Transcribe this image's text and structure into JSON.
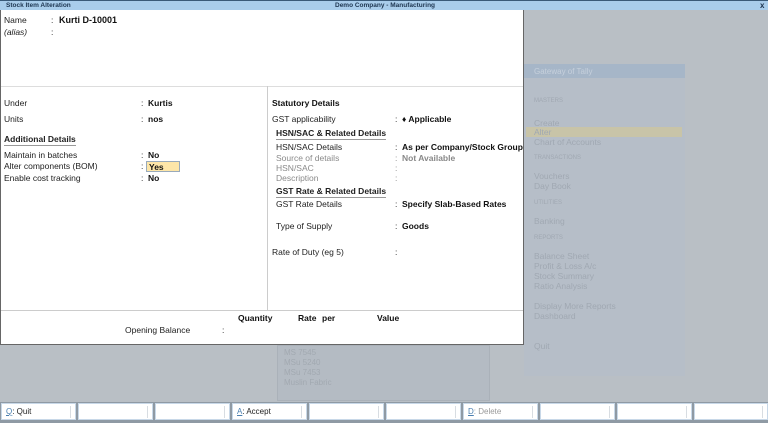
{
  "titlebar": {
    "screen": "Stock Item Alteration",
    "company": "Demo Company - Manufacturing",
    "close": "x"
  },
  "form": {
    "name_label": "Name",
    "name_value": "Kurti D-10001",
    "alias_label": "(alias)",
    "under_label": "Under",
    "under_value": "Kurtis",
    "units_label": "Units",
    "units_value": "nos",
    "additional_header": "Additional Details",
    "batches_label": "Maintain in batches",
    "batches_value": "No",
    "bom_label": "Alter components (BOM)",
    "bom_value": "Yes",
    "cost_label": "Enable cost tracking",
    "cost_value": "No",
    "statutory_header": "Statutory Details",
    "gst_app_label": "GST applicability",
    "gst_app_value": "♦ Applicable",
    "hsn_header": "HSN/SAC & Related Details",
    "hsn_details_label": "HSN/SAC Details",
    "hsn_details_value": "As per Company/Stock Group",
    "source_label": "Source of details",
    "source_value": "Not Available",
    "hsn_label": "HSN/SAC",
    "desc_label": "Description",
    "gst_rate_header": "GST Rate & Related Details",
    "gst_rate_label": "GST Rate Details",
    "gst_rate_value": "Specify Slab-Based Rates",
    "supply_label": "Type of Supply",
    "supply_value": "Goods",
    "duty_label": "Rate of Duty (eg 5)",
    "opening": {
      "quantity": "Quantity",
      "rate": "Rate",
      "per": "per",
      "value": "Value",
      "label": "Opening Balance"
    }
  },
  "gateway": {
    "title": "Gateway of Tally",
    "items": [
      "MASTERS",
      "Create",
      "Alter",
      "Chart of Accounts",
      "TRANSACTIONS",
      "Vouchers",
      "Day Book",
      "UTILITIES",
      "Banking",
      "REPORTS",
      "Balance Sheet",
      "Profit & Loss A/c",
      "Stock Summary",
      "Ratio Analysis",
      "Display More Reports",
      "Dashboard",
      "Quit"
    ]
  },
  "bglist": {
    "items": [
      "MS 7545",
      "MSu 5240",
      "MSu 7453",
      "Muslin Fabric"
    ]
  },
  "buttons": [
    {
      "key": "Q",
      "label": ": Quit"
    },
    {
      "key": "",
      "label": ""
    },
    {
      "key": "",
      "label": ""
    },
    {
      "key": "A",
      "label": ": Accept"
    },
    {
      "key": "",
      "label": ""
    },
    {
      "key": "",
      "label": ""
    },
    {
      "key": "D",
      "label": ": Delete"
    },
    {
      "key": "",
      "label": ""
    },
    {
      "key": "",
      "label": ""
    },
    {
      "key": "",
      "label": ""
    }
  ],
  "colors": {
    "titlebar": "#a9cdeb",
    "highlight": "#fde6a8",
    "background": "#b9bfc5"
  }
}
